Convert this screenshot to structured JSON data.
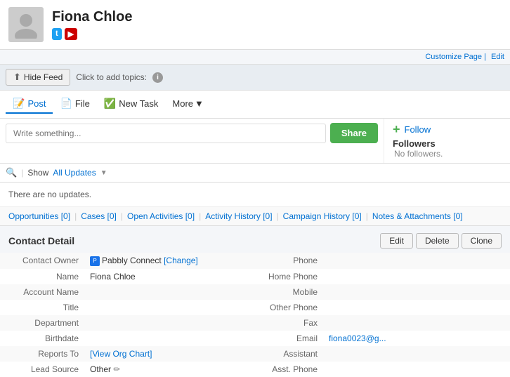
{
  "header": {
    "name": "Fiona Chloe",
    "twitter_label": "t",
    "youtube_label": "▶"
  },
  "topbar": {
    "customize_page": "Customize Page",
    "edit": "Edit"
  },
  "feed": {
    "hide_feed_label": "Hide Feed",
    "click_to_add": "Click to add topics:",
    "info_char": "i"
  },
  "actions": {
    "post_label": "Post",
    "file_label": "File",
    "new_task_label": "New Task",
    "more_label": "More",
    "post_icon": "📝",
    "file_icon": "📄",
    "task_icon": "✅"
  },
  "input": {
    "placeholder": "Write something...",
    "share_label": "Share"
  },
  "follow": {
    "plus": "+",
    "follow_label": "Follow",
    "followers_label": "Followers",
    "no_followers": "No followers."
  },
  "updates": {
    "search_icon": "🔍",
    "show_label": "Show",
    "all_updates_label": "All Updates",
    "no_updates_text": "There are no updates."
  },
  "subnav": {
    "items": [
      {
        "label": "Opportunities [0]"
      },
      {
        "label": "Cases [0]"
      },
      {
        "label": "Open Activities [0]"
      },
      {
        "label": "Activity History [0]"
      },
      {
        "label": "Campaign History [0]"
      },
      {
        "label": "Notes & Attachments [0]"
      }
    ]
  },
  "contact_detail": {
    "title": "Contact Detail",
    "edit_label": "Edit",
    "delete_label": "Delete",
    "clone_label": "Clone",
    "fields": [
      {
        "label": "Contact Owner",
        "value": "Pabbly Connect",
        "change": "[Change]",
        "has_icon": true,
        "right_label": "Phone",
        "right_value": ""
      },
      {
        "label": "Name",
        "value": "Fiona Chloe",
        "right_label": "Home Phone",
        "right_value": ""
      },
      {
        "label": "Account Name",
        "value": "",
        "right_label": "Mobile",
        "right_value": ""
      },
      {
        "label": "Title",
        "value": "",
        "right_label": "Other Phone",
        "right_value": ""
      },
      {
        "label": "Department",
        "value": "",
        "right_label": "Fax",
        "right_value": ""
      },
      {
        "label": "Birthdate",
        "value": "",
        "right_label": "Email",
        "right_value": "fiona0023@g..."
      },
      {
        "label": "Reports To",
        "value": "[View Org Chart]",
        "is_org_link": true,
        "right_label": "Assistant",
        "right_value": ""
      },
      {
        "label": "Lead Source",
        "value": "Other",
        "has_edit": true,
        "right_label": "Asst. Phone",
        "right_value": ""
      }
    ]
  }
}
